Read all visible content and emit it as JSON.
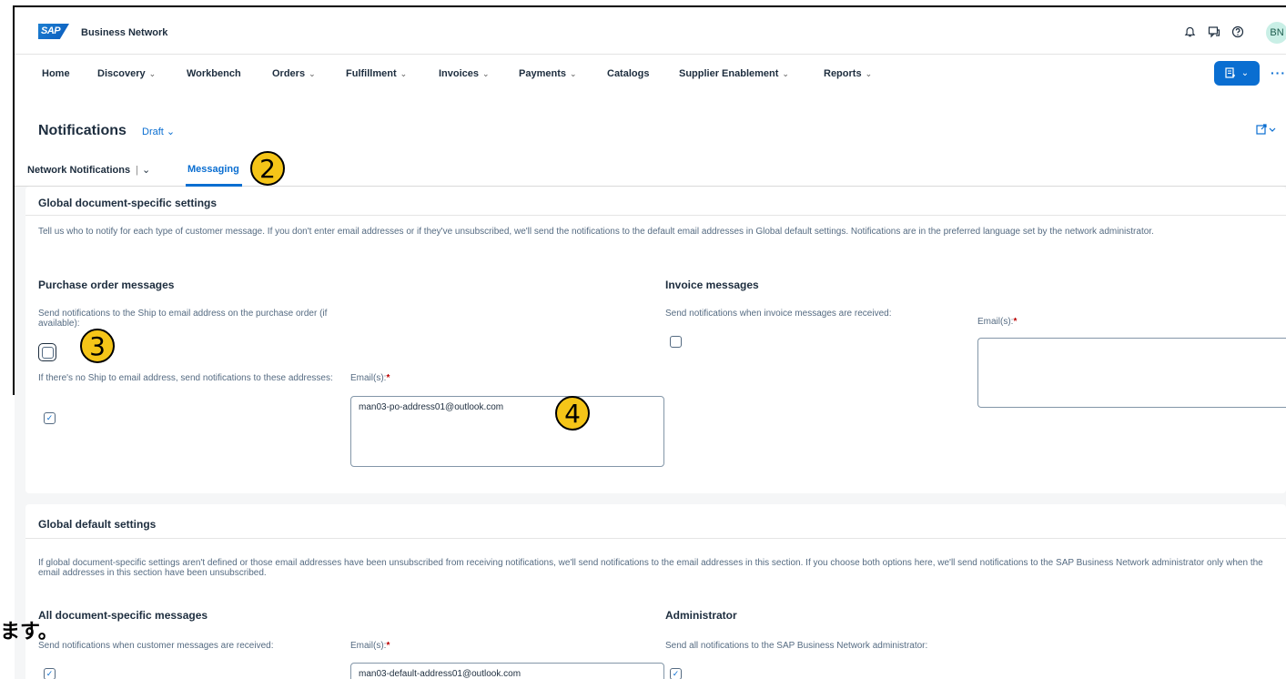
{
  "shell": {
    "logo_text": "SAP",
    "brand": "Business Network",
    "icons": [
      "bell-icon",
      "feedback-icon",
      "help-icon"
    ],
    "avatar_initials": "BN"
  },
  "nav": {
    "items": [
      {
        "label": "Home",
        "dropdown": false
      },
      {
        "label": "Discovery",
        "dropdown": true
      },
      {
        "label": "Workbench",
        "dropdown": false
      },
      {
        "label": "Orders",
        "dropdown": true
      },
      {
        "label": "Fulfillment",
        "dropdown": true
      },
      {
        "label": "Invoices",
        "dropdown": true
      },
      {
        "label": "Payments",
        "dropdown": true
      },
      {
        "label": "Catalogs",
        "dropdown": false
      },
      {
        "label": "Supplier Enablement",
        "dropdown": true
      },
      {
        "label": "Reports",
        "dropdown": true
      }
    ],
    "more": "···"
  },
  "header": {
    "title": "Notifications",
    "status": "Draft"
  },
  "tabs": {
    "network": "Network Notifications",
    "messaging": "Messaging"
  },
  "global_doc": {
    "title": "Global document-specific settings",
    "description": "Tell us who to notify for each type of customer message. If you don't enter email addresses or if they've unsubscribed, we'll send the notifications to the default email addresses in Global default settings. Notifications are in the preferred language set by the network administrator.",
    "po": {
      "title": "Purchase order messages",
      "ship_to_label": "Send notifications to the Ship to email address on the purchase order (if available):",
      "ship_to_checked": false,
      "fallback_label": "If there's no Ship to email address, send notifications to these addresses:",
      "fallback_checked": true,
      "emails_label": "Email(s):",
      "emails_value": "man03-po-address01@outlook.com"
    },
    "invoice": {
      "title": "Invoice messages",
      "label": "Send notifications when invoice messages are received:",
      "checked": false,
      "emails_label": "Email(s):",
      "emails_value": ""
    }
  },
  "global_default": {
    "title": "Global default settings",
    "description": "If global document-specific settings aren't defined or those email addresses have been unsubscribed from receiving notifications, we'll send notifications to the email addresses in this section. If you choose both options here, we'll send notifications to the SAP Business Network administrator only when the email addresses in this section have been unsubscribed.",
    "all_docs": {
      "title": "All document-specific messages",
      "label": "Send notifications when customer messages are received:",
      "checked": true,
      "emails_label": "Email(s):",
      "emails_value": "man03-default-address01@outlook.com"
    },
    "admin": {
      "title": "Administrator",
      "label": "Send all notifications to the SAP Business Network administrator:",
      "checked": true
    }
  },
  "callouts": [
    "2",
    "3",
    "4"
  ],
  "overlay_text": "ます。"
}
